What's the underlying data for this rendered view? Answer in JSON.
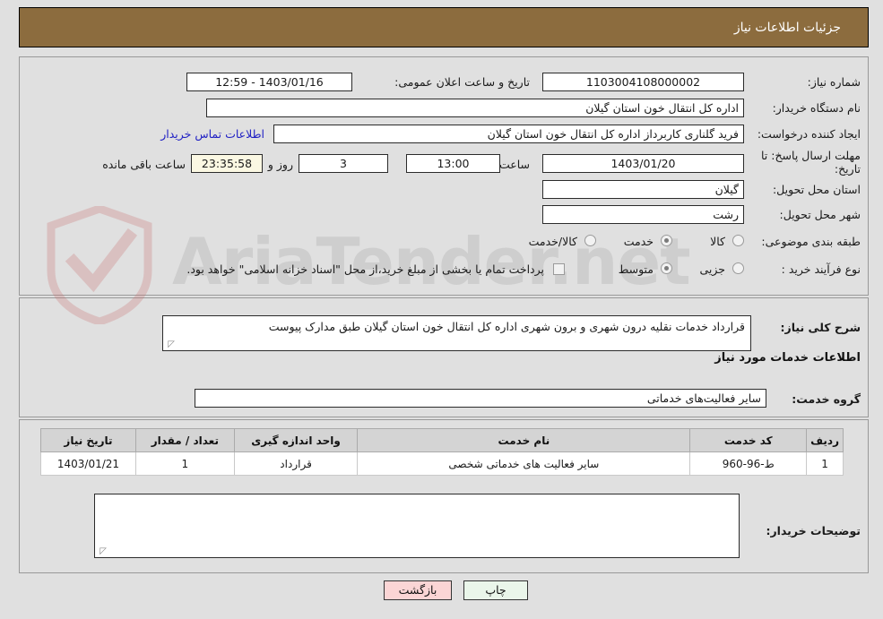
{
  "header": {
    "title": "جزئیات اطلاعات نیاز"
  },
  "fields": {
    "need_number_label": "شماره نیاز:",
    "need_number_value": "1103004108000002",
    "public_announce_label": "تاریخ و ساعت اعلان عمومی:",
    "public_announce_value": "1403/01/16 - 12:59",
    "buyer_org_label": "نام دستگاه خریدار:",
    "buyer_org_value": "اداره کل انتقال خون استان گیلان",
    "requester_label": "ایجاد کننده درخواست:",
    "requester_value": "فرید گلناری کاربرداز اداره کل انتقال خون استان گیلان",
    "buyer_contact_link": "اطلاعات تماس خریدار",
    "deadline_label": "مهلت ارسال پاسخ: تا تاریخ:",
    "deadline_date": "1403/01/20",
    "hour_label": "ساعت",
    "hour_value": "13:00",
    "days_value": "3",
    "days_suffix": "روز و",
    "countdown_value": "23:35:58",
    "countdown_suffix": "ساعت باقی مانده",
    "province_label": "استان محل تحویل:",
    "province_value": "گیلان",
    "city_label": "شهر محل تحویل:",
    "city_value": "رشت"
  },
  "classification": {
    "label": "طبقه بندی موضوعی:",
    "options": [
      {
        "label": "کالا",
        "selected": false
      },
      {
        "label": "خدمت",
        "selected": true
      },
      {
        "label": "کالا/خدمت",
        "selected": false
      }
    ]
  },
  "purchase_process": {
    "label": "نوع فرآیند خرید :",
    "options": [
      {
        "label": "جزیی",
        "selected": false
      },
      {
        "label": "متوسط",
        "selected": true
      }
    ]
  },
  "islamic_treasury": {
    "checked": false,
    "text": "پرداخت تمام یا بخشی از مبلغ خرید،از محل \"اسناد خزانه اسلامی\" خواهد بود."
  },
  "general_desc": {
    "label": "شرح کلی نیاز:",
    "value": "قرارداد خدمات نقلیه درون شهری و برون شهری اداره کل انتقال خون استان گیلان طبق مدارک پیوست"
  },
  "services_section": {
    "heading": "اطلاعات خدمات مورد نیاز",
    "group_label": "گروه خدمت:",
    "group_value": "سایر فعالیت‌های خدماتی"
  },
  "table": {
    "headers": [
      "ردیف",
      "کد خدمت",
      "نام خدمت",
      "واحد اندازه گیری",
      "تعداد / مقدار",
      "تاریخ نیاز"
    ],
    "rows": [
      {
        "row": "1",
        "code": "ط-96-960",
        "name": "سایر فعالیت های خدماتی شخصی",
        "unit": "قرارداد",
        "qty": "1",
        "date": "1403/01/21"
      }
    ]
  },
  "buyer_notes": {
    "label": "توضیحات خریدار:",
    "value": ""
  },
  "buttons": {
    "print": "چاپ",
    "back": "بازگشت"
  },
  "watermark": {
    "text": "AriaTender.net"
  },
  "colors": {
    "header_bg": "#8C6C3E",
    "page_bg": "#E0E0E0",
    "link": "#2121C4",
    "countdown_bg": "#FBF8E3",
    "print_btn_bg": "#EAF6EA",
    "back_btn_bg": "#FBD5D5"
  }
}
